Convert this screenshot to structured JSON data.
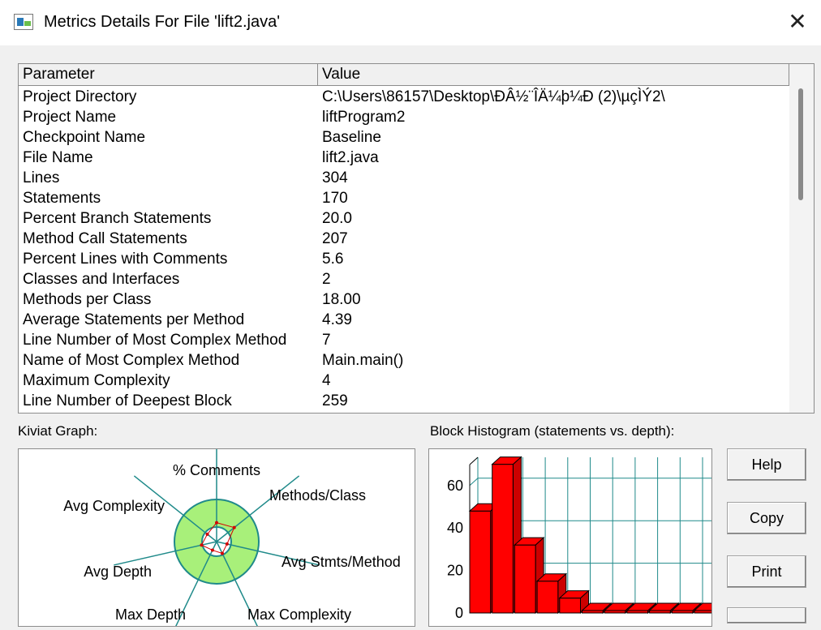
{
  "window": {
    "title": "Metrics Details For File 'lift2.java'"
  },
  "table": {
    "headers": {
      "parameter": "Parameter",
      "value": "Value"
    },
    "rows": [
      {
        "parameter": "Project Directory",
        "value": "C:\\Users\\86157\\Desktop\\ÐÂ½¨ÎÄ¼þ¼Ð (2)\\µçÌÝ2\\"
      },
      {
        "parameter": "Project Name",
        "value": "liftProgram2"
      },
      {
        "parameter": "Checkpoint Name",
        "value": "Baseline"
      },
      {
        "parameter": "File Name",
        "value": "lift2.java"
      },
      {
        "parameter": "Lines",
        "value": "304"
      },
      {
        "parameter": "Statements",
        "value": "170"
      },
      {
        "parameter": "Percent Branch Statements",
        "value": "20.0"
      },
      {
        "parameter": "Method Call Statements",
        "value": "207"
      },
      {
        "parameter": "Percent Lines with Comments",
        "value": "5.6"
      },
      {
        "parameter": "Classes and Interfaces",
        "value": "2"
      },
      {
        "parameter": "Methods per Class",
        "value": "18.00"
      },
      {
        "parameter": "Average Statements per Method",
        "value": "4.39"
      },
      {
        "parameter": "Line Number of Most Complex Method",
        "value": "7"
      },
      {
        "parameter": "Name of Most Complex Method",
        "value": "Main.main()"
      },
      {
        "parameter": "Maximum Complexity",
        "value": "4"
      },
      {
        "parameter": "Line Number of Deepest Block",
        "value": "259"
      }
    ]
  },
  "kiviat": {
    "label": "Kiviat Graph:",
    "axes": [
      "% Comments",
      "Methods/Class",
      "Avg Stmts/Method",
      "Max Complexity",
      "Max Depth",
      "Avg Depth",
      "Avg Complexity"
    ],
    "inner_color": "#ffffff",
    "band_color": "#a8f07a",
    "axis_color": "#1f8a8a",
    "polygon_color": "#d40000"
  },
  "histogram": {
    "label": "Block Histogram (statements vs. depth):",
    "y_ticks": [
      "60",
      "40",
      "20",
      "0"
    ],
    "y_max": 80,
    "values": [
      48,
      70,
      32,
      15,
      7,
      1,
      1,
      1,
      1,
      1,
      1
    ],
    "bar_color": "#ff0000",
    "grid_color": "#1f8a8a"
  },
  "buttons": {
    "help": "Help",
    "copy": "Copy",
    "print": "Print"
  }
}
